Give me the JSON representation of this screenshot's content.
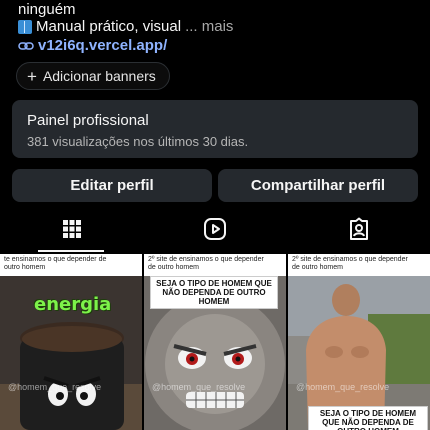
{
  "bio": {
    "name_line": "ninguém",
    "desc": "Manual prático, visual",
    "more": "... mais",
    "link": "v12i6q.vercel.app/"
  },
  "banner_button": {
    "label": "Adicionar banners"
  },
  "professional_panel": {
    "title": "Painel profissional",
    "subtitle": "381 visualizações nos últimos 30 dias."
  },
  "actions": {
    "edit_label": "Editar perfil",
    "share_label": "Compartilhar perfil"
  },
  "tabs": [
    {
      "icon": "grid-icon",
      "active": true
    },
    {
      "icon": "reels-icon",
      "active": false
    },
    {
      "icon": "tagged-icon",
      "active": false
    }
  ],
  "posts": [
    {
      "caption": "te ensinamos o que depender de outro homem",
      "overlay": "energia",
      "watermark": "@homem_que_resolve"
    },
    {
      "caption": "2º site de ensinamos o que depender de outro homem",
      "overlay": "SEJA O TIPO DE HOMEM QUE NÃO DEPENDA DE OUTRO HOMEM",
      "watermark": "@homem_que_resolve"
    },
    {
      "caption": "2º site de ensinamos o que depender de outro homem",
      "overlay": "SEJA O TIPO DE HOMEM QUE NÃO DEPENDA DE OUTRO HOMEM",
      "watermark": "@homem_que_resolve"
    }
  ],
  "colors": {
    "bg": "#000000",
    "panel": "#25292e",
    "link": "#8fb3ff",
    "accent_green": "#7df24a"
  }
}
